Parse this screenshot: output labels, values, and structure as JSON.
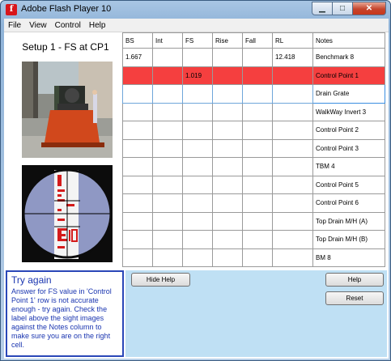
{
  "window": {
    "title": "Adobe Flash Player 10",
    "icon_glyph": "f",
    "controls": [
      "minimize-icon",
      "maximize-icon",
      "close-icon"
    ]
  },
  "menu": {
    "items": [
      {
        "label": "File"
      },
      {
        "label": "View"
      },
      {
        "label": "Control"
      },
      {
        "label": "Help"
      }
    ]
  },
  "setup": {
    "title": "Setup 1 - FS at CP1"
  },
  "table": {
    "headers": [
      "BS",
      "Int",
      "FS",
      "Rise",
      "Fall",
      "RL",
      "Notes"
    ],
    "rows": [
      [
        "1.667",
        "",
        "",
        "",
        "",
        "12.418",
        "Benchmark 8"
      ],
      [
        "",
        "",
        "1.019",
        "",
        "",
        "",
        "Control Point 1"
      ],
      [
        "",
        "",
        "",
        "",
        "",
        "",
        "Drain Grate"
      ],
      [
        "",
        "",
        "",
        "",
        "",
        "",
        "WalkWay Invert 3"
      ],
      [
        "",
        "",
        "",
        "",
        "",
        "",
        "Control Point 2"
      ],
      [
        "",
        "",
        "",
        "",
        "",
        "",
        "Control Point 3"
      ],
      [
        "",
        "",
        "",
        "",
        "",
        "",
        "TBM 4"
      ],
      [
        "",
        "",
        "",
        "",
        "",
        "",
        "Control Point 5"
      ],
      [
        "",
        "",
        "",
        "",
        "",
        "",
        "Control Point 6"
      ],
      [
        "",
        "",
        "",
        "",
        "",
        "",
        "Top Drain M/H (A)"
      ],
      [
        "",
        "",
        "",
        "",
        "",
        "",
        "Top Drain M/H (B)"
      ],
      [
        "",
        "",
        "",
        "",
        "",
        "",
        "BM 8"
      ]
    ],
    "highlight_color": "#f53f3f"
  },
  "help": {
    "title": "Try again",
    "text": "Answer for FS value in 'Control Point 1' row is not accurate enough - try again. Check the label above the sight images against the Notes column to make sure you are on the right cell.",
    "color": "#1a35b0"
  },
  "buttons": {
    "hide_help": "Hide Help",
    "help": "Help",
    "reset": "Reset"
  },
  "colors": {
    "bottom_panel": "#bfe0f4",
    "help_border": "#2a47b8"
  }
}
